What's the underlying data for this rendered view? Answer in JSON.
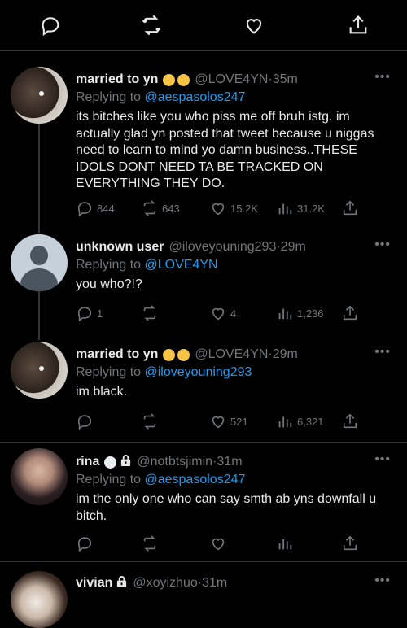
{
  "tweets": [
    {
      "name": "married to yn",
      "handle": "@LOVE4YN",
      "time": "35m",
      "replying_prefix": "Replying to ",
      "replying_to": "@aespasolos247",
      "text": "its bitches like you who piss me off bruh istg. im actually glad yn posted that tweet because u niggas need to learn to mind yo damn business..THESE IDOLS DONT NEED TA BE TRACKED ON EVERYTHING THEY DO.",
      "replies": "844",
      "retweets": "643",
      "likes": "15.2K",
      "views": "31.2K"
    },
    {
      "name": "unknown user",
      "handle": "@iloveyouning293",
      "time": "29m",
      "replying_prefix": "Replying to ",
      "replying_to": "@LOVE4YN",
      "text": "you who?!?",
      "replies": "1",
      "retweets": "",
      "likes": "4",
      "views": "1,236"
    },
    {
      "name": "married to yn",
      "handle": "@LOVE4YN",
      "time": "29m",
      "replying_prefix": "Replying to ",
      "replying_to": "@iloveyouning293",
      "text": "im black.",
      "replies": "",
      "retweets": "",
      "likes": "521",
      "views": "6,321"
    },
    {
      "name": "rina",
      "handle": "@notbtsjimin",
      "time": "31m",
      "replying_prefix": "Replying to ",
      "replying_to": "@aespasolos247",
      "text": "im the only one who can say smth ab yns downfall u bitch.",
      "replies": "",
      "retweets": "",
      "likes": "",
      "views": ""
    },
    {
      "name": "vivian",
      "handle": "@xoyizhuo",
      "time": "31m"
    }
  ],
  "more_glyph": "•••",
  "time_sep": " · ",
  "colors": {
    "accent": "#1d9bf0",
    "muted": "#71767b",
    "background": "#000000",
    "text": "#e7e9ea"
  }
}
